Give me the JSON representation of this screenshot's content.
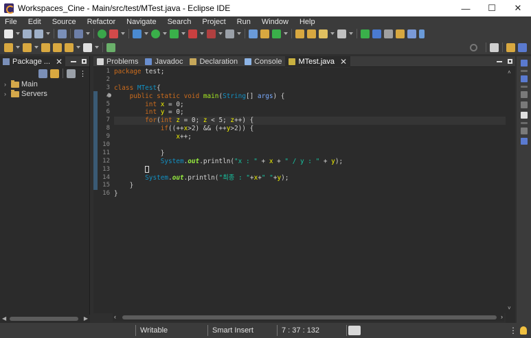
{
  "window": {
    "title": "Workspaces_Cine - Main/src/test/MTest.java - Eclipse IDE",
    "controls": [
      "—",
      "☐",
      "✕"
    ]
  },
  "menu": [
    "File",
    "Edit",
    "Source",
    "Refactor",
    "Navigate",
    "Search",
    "Project",
    "Run",
    "Window",
    "Help"
  ],
  "left_panel": {
    "tab_label": "Package ...",
    "tree": [
      {
        "label": "Main"
      },
      {
        "label": "Servers"
      }
    ]
  },
  "editor": {
    "tabs": [
      {
        "label": "Problems",
        "icon": "problems-icon",
        "color": "#d6d6d6"
      },
      {
        "label": "Javadoc",
        "icon": "javadoc-icon",
        "color": "#6a8fd0"
      },
      {
        "label": "Declaration",
        "icon": "declaration-icon",
        "color": "#c7a85a"
      },
      {
        "label": "Console",
        "icon": "console-icon",
        "color": "#8db4e6"
      },
      {
        "label": "MTest.java",
        "icon": "java-file-icon",
        "color": "#c8b040",
        "active": true
      }
    ],
    "line_numbers": [
      "1",
      "2",
      "3",
      "4",
      "5",
      "6",
      "7",
      "8",
      "9",
      "10",
      "11",
      "12",
      "13",
      "14",
      "15",
      "16"
    ],
    "code_lines": [
      "package test;",
      "",
      "class MTest{",
      "    public static void main(String[] args) {",
      "        int x = 0;",
      "        int y = 0;",
      "        for(int z = 0; z < 5; z++) {",
      "            if((++x>2) && (++y>2)) {",
      "                x++;",
      "",
      "            }",
      "            System.out.println(\"x : \" + x + \" / y : \" + y);",
      "        }",
      "        System.out.println(\"최종 : \"+x+\" \"+y);",
      "    }",
      "}"
    ]
  },
  "status": {
    "writable": "Writable",
    "insert_mode": "Smart Insert",
    "position": "7 : 37 : 132"
  },
  "colors": {
    "keyword": "#cc6c1d",
    "class": "#1290c3",
    "string": "#17c6a3",
    "static_field": "#96ec3f",
    "background": "#2b2b2b"
  }
}
